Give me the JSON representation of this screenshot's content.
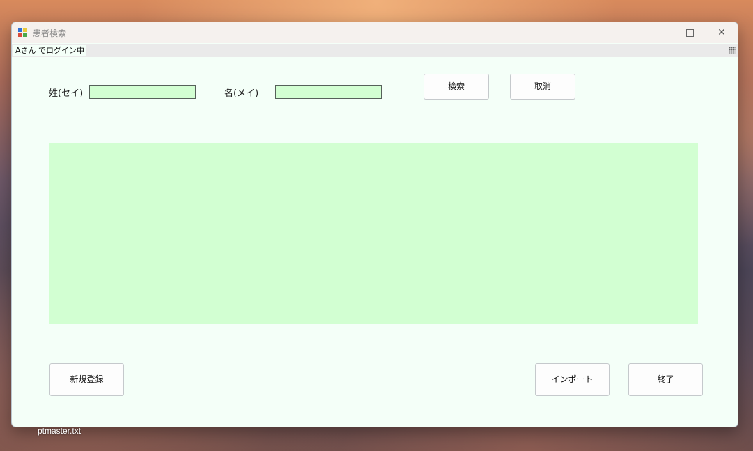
{
  "window": {
    "title": "患者検索",
    "controls": {
      "minimize": "minimize-icon",
      "maximize": "maximize-icon",
      "close": "close-icon"
    }
  },
  "status": {
    "login_text": "Aさん でログイン中"
  },
  "search": {
    "sei_label": "姓(セイ)",
    "sei_value": "",
    "mei_label": "名(メイ)",
    "mei_value": "",
    "search_button": "検索",
    "cancel_button": "取消"
  },
  "results": {
    "rows": []
  },
  "footer": {
    "new_button": "新規登録",
    "import_button": "インポート",
    "exit_button": "終了"
  },
  "desktop": {
    "file_label": "ptmaster.txt"
  },
  "colors": {
    "form_background": "#f4fff8",
    "input_background": "#d2ffd2",
    "grid_background": "#d2ffd2"
  }
}
